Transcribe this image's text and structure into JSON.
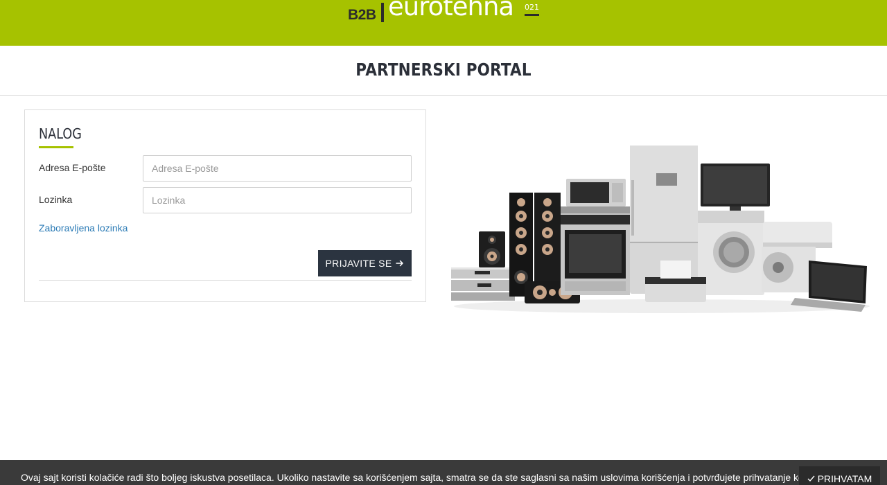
{
  "header": {
    "logo_b2b": "B2B",
    "logo_brand": "eurotehna",
    "logo_sup": "021",
    "brand_color": "#a6c200"
  },
  "page": {
    "title": "PARTNERSKI PORTAL"
  },
  "login": {
    "section_title": "NALOG",
    "email_label": "Adresa E-pošte",
    "email_placeholder": "Adresa E-pošte",
    "email_value": "",
    "password_label": "Lozinka",
    "password_placeholder": "Lozinka",
    "password_value": "",
    "forgot_link": "Zaboravljena lozinka",
    "submit_label": "PRIJAVITE SE",
    "submit_icon": "arrow-right-icon",
    "button_color": "#2b3440"
  },
  "hero": {
    "image_subject": "home-appliances-illustration"
  },
  "cookie": {
    "text": "Ovaj sajt koristi kolačiće radi što boljeg iskustva posetilaca. Ukoliko nastavite sa korišćenjem sajta, smatra se da ste saglasni sa našim uslovima korišćenja i potvrđujete prihvatanje kolačića.",
    "accept_label": "PRIHVATAM",
    "accept_icon": "check-icon"
  }
}
